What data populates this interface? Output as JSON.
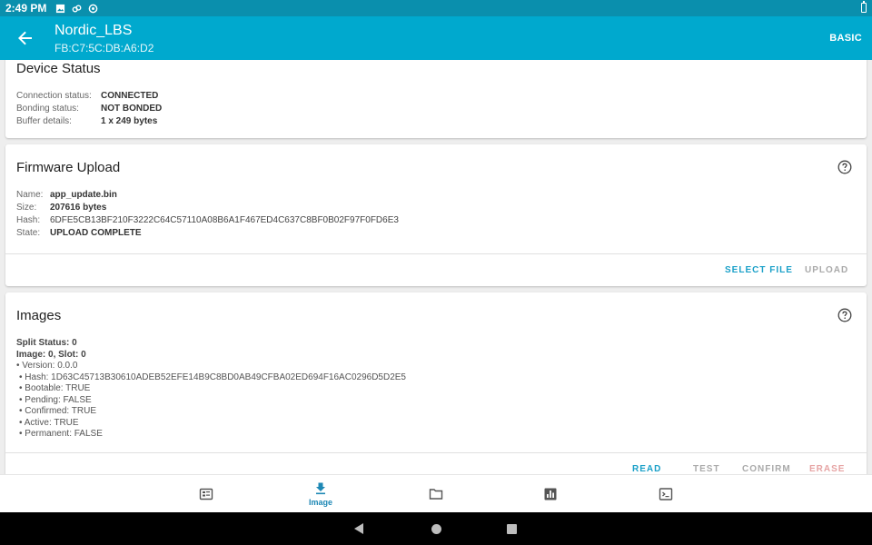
{
  "status_bar": {
    "time": "2:49 PM"
  },
  "app_bar": {
    "title": "Nordic_LBS",
    "subtitle": "FB:C7:5C:DB:A6:D2",
    "menu_label": "BASIC"
  },
  "device_status": {
    "title": "Device Status",
    "rows": [
      {
        "key": "Connection status:",
        "value": "CONNECTED"
      },
      {
        "key": "Bonding status:",
        "value": "NOT BONDED"
      },
      {
        "key": "Buffer details:",
        "value": "1 x 249 bytes"
      }
    ]
  },
  "firmware_upload": {
    "title": "Firmware Upload",
    "rows": [
      {
        "key": "Name:",
        "value": "app_update.bin"
      },
      {
        "key": "Size:",
        "value": "207616 bytes"
      },
      {
        "key": "Hash:",
        "value": "6DFE5CB13BF210F3222C64C57110A08B6A1F467ED4C637C8BF0B02F97F0FD6E3"
      },
      {
        "key": "State:",
        "value": "UPLOAD COMPLETE"
      }
    ],
    "actions": {
      "select_file": "SELECT FILE",
      "upload": "UPLOAD"
    }
  },
  "images": {
    "title": "Images",
    "split_status": "Split Status: 0",
    "image_slot": "Image: 0, Slot: 0",
    "version": "• Version: 0.0.0",
    "hash": "• Hash: 1D63C45713B30610ADEB52EFE14B9C8BD0AB49CFBA02ED694F16AC0296D5D2E5",
    "bootable": "• Bootable: TRUE",
    "pending": "• Pending: FALSE",
    "confirmed": "• Confirmed: TRUE",
    "active": "• Active: TRUE",
    "permanent": "• Permanent: FALSE",
    "actions": {
      "read": "READ",
      "test": "TEST",
      "confirm": "CONFIRM",
      "erase": "ERASE"
    }
  },
  "bottom_nav": {
    "items": [
      {
        "icon": "device-icon",
        "label": ""
      },
      {
        "icon": "image-download-icon",
        "label": "Image"
      },
      {
        "icon": "folder-icon",
        "label": ""
      },
      {
        "icon": "stats-icon",
        "label": ""
      },
      {
        "icon": "terminal-icon",
        "label": ""
      }
    ]
  },
  "colors": {
    "status_bar": "#0a8fad",
    "app_bar": "#00a9ce",
    "accent": "#1aa0c8",
    "disabled": "#aaaaaa",
    "erase": "#e6a4a4"
  }
}
